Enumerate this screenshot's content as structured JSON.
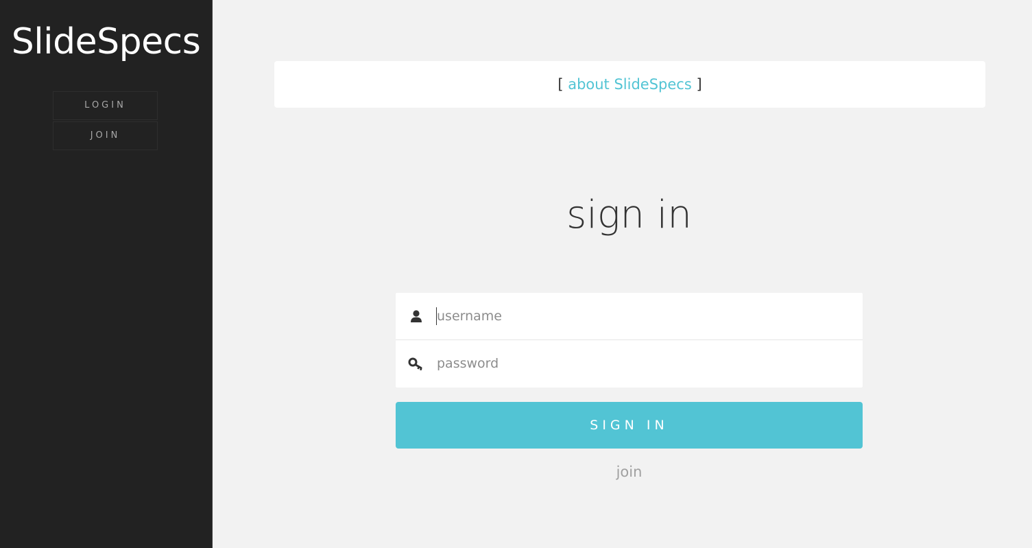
{
  "app": {
    "logo": "SlideSpecs"
  },
  "sidebar": {
    "items": [
      {
        "label": "LOGIN"
      },
      {
        "label": "JOIN"
      }
    ]
  },
  "about_bar": {
    "open_bracket": "[",
    "link_label": "about SlideSpecs",
    "close_bracket": "]"
  },
  "signin": {
    "title": "sign in",
    "username_placeholder": "username",
    "password_placeholder": "password",
    "submit_label": "SIGN IN",
    "join_label": "join",
    "username_icon": "user-icon",
    "password_icon": "key-icon"
  },
  "colors": {
    "accent": "#52c4d4",
    "sidebar_bg": "#222222",
    "page_bg": "#f2f2f2"
  }
}
